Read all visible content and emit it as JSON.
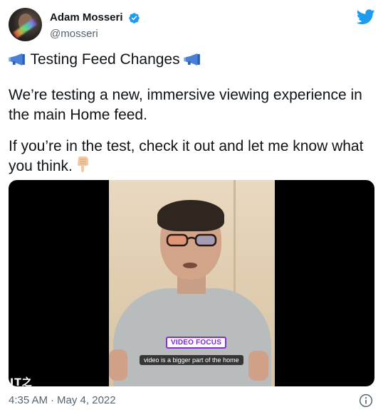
{
  "author": {
    "display_name": "Adam Mosseri",
    "handle": "@mosseri",
    "verified": true,
    "avatar_icon": "avatar-photo"
  },
  "tweet": {
    "heading": "Testing Feed Changes",
    "heading_icon": "megaphone-icon",
    "paragraph_1": "We’re testing a new, immersive viewing experience in the main Home feed.",
    "paragraph_2": "If you’re in the test, check it out and let me know what you think.",
    "paragraph_2_icon": "pointing-down-hand-icon"
  },
  "video": {
    "tag": "VIDEO FOCUS",
    "caption": "video is a bigger part of the home",
    "watermark": "IT之"
  },
  "footer": {
    "time": "4:35 AM",
    "separator": "·",
    "date": "May 4, 2022"
  },
  "icons": {
    "brand": "twitter-bird-icon",
    "verified": "verified-badge-icon",
    "info": "info-icon"
  },
  "colors": {
    "brand_blue": "#1d9bf0",
    "text": "#0f1419",
    "secondary_text": "#536471",
    "video_tag": "#7b2ad6"
  }
}
